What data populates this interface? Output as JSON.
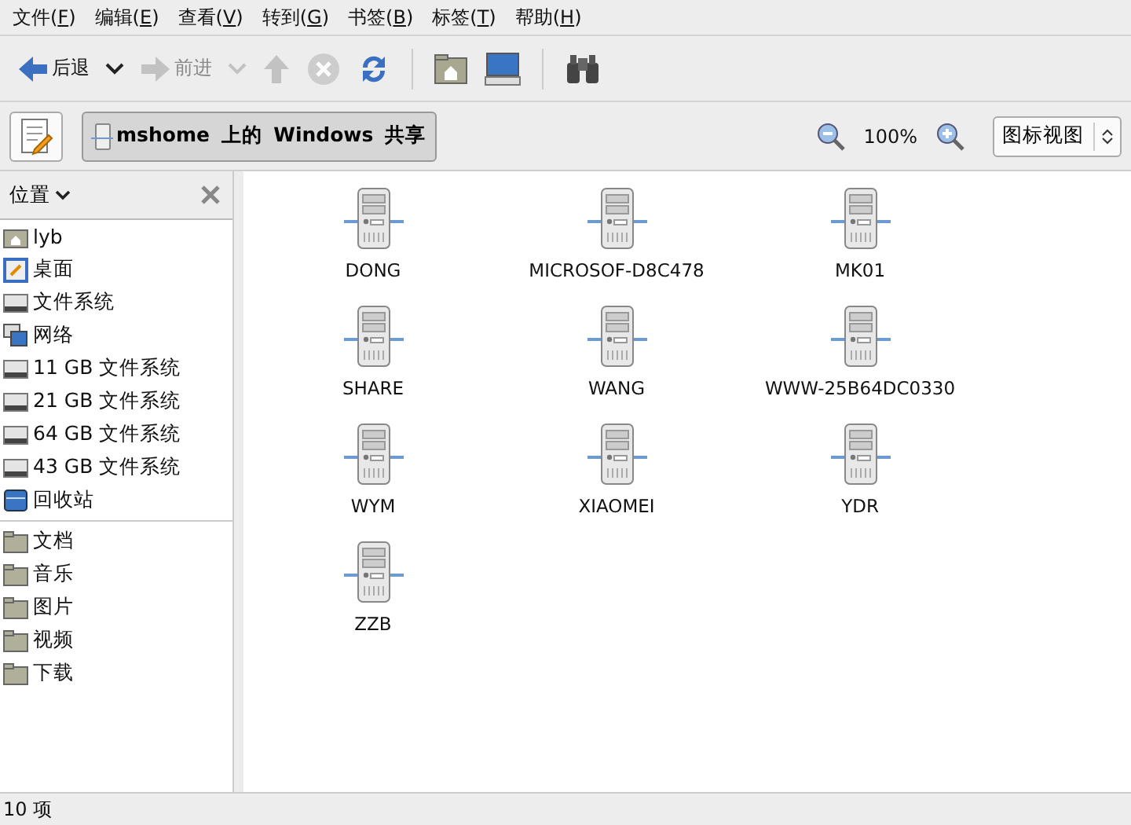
{
  "menu": [
    {
      "before": "文件(",
      "key": "F",
      "after": ")"
    },
    {
      "before": "编辑(",
      "key": "E",
      "after": ")"
    },
    {
      "before": "查看(",
      "key": "V",
      "after": ")"
    },
    {
      "before": "转到(",
      "key": "G",
      "after": ")"
    },
    {
      "before": "书签(",
      "key": "B",
      "after": ")"
    },
    {
      "before": "标签(",
      "key": "T",
      "after": ")"
    },
    {
      "before": "帮助(",
      "key": "H",
      "after": ")"
    }
  ],
  "toolbar": [
    {
      "kind": "back",
      "label": "后退",
      "disabled": false
    },
    {
      "kind": "dropdown",
      "disabled": false
    },
    {
      "kind": "forward",
      "label": "前进",
      "disabled": true
    },
    {
      "kind": "dropdown",
      "disabled": true
    },
    {
      "kind": "up",
      "disabled": true
    },
    {
      "kind": "stop",
      "disabled": true
    },
    {
      "kind": "reload",
      "disabled": false
    },
    {
      "kind": "separator"
    },
    {
      "kind": "home",
      "disabled": false
    },
    {
      "kind": "computer",
      "disabled": false
    },
    {
      "kind": "separator"
    },
    {
      "kind": "search",
      "disabled": false
    }
  ],
  "location": {
    "path": "mshome 上的 Windows 共享",
    "zoom": "100%",
    "view": "图标视图"
  },
  "sidebar": {
    "title": "位置",
    "sections": [
      [
        {
          "kind": "home",
          "label": "lyb"
        },
        {
          "kind": "desktop",
          "label": "桌面"
        },
        {
          "kind": "drive",
          "label": "文件系统"
        },
        {
          "kind": "network",
          "label": "网络"
        },
        {
          "kind": "drive",
          "label": "11 GB 文件系统"
        },
        {
          "kind": "drive",
          "label": "21 GB 文件系统"
        },
        {
          "kind": "drive",
          "label": "64 GB 文件系统"
        },
        {
          "kind": "drive",
          "label": "43 GB 文件系统"
        },
        {
          "kind": "trash",
          "label": "回收站"
        }
      ],
      [
        {
          "kind": "folder",
          "label": "文档"
        },
        {
          "kind": "folder",
          "label": "音乐"
        },
        {
          "kind": "folder",
          "label": "图片"
        },
        {
          "kind": "folder",
          "label": "视频"
        },
        {
          "kind": "folder",
          "label": "下载"
        }
      ]
    ]
  },
  "items": [
    "DONG",
    "MICROSOF-D8C478",
    "MK01",
    "SHARE",
    "WANG",
    "WWW-25B64DC0330",
    "WYM",
    "XIAOMEI",
    "YDR",
    "ZZB"
  ],
  "status_bar": "10 项"
}
